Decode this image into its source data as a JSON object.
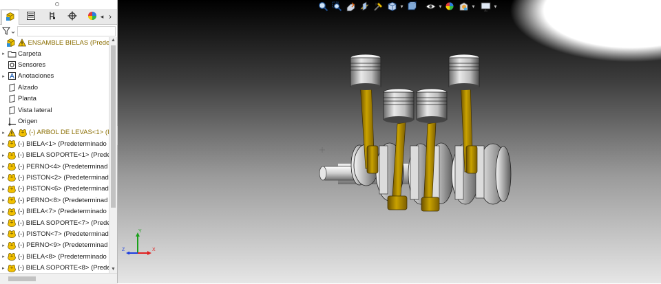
{
  "colors": {
    "assembly_yellow": "#e4b400",
    "warning_yellow": "#f2c200",
    "feature_blue": "#1e5fb4",
    "axis_x": "#e02020",
    "axis_y": "#1aa01a",
    "axis_z": "#1a3ce0"
  },
  "panel": {
    "tabs": [
      {
        "name": "featuremanager-tab",
        "icon": "assembly-tree-icon",
        "active": true
      },
      {
        "name": "propertymanager-tab",
        "icon": "property-list-icon",
        "active": false
      },
      {
        "name": "configurationmanager-tab",
        "icon": "configuration-icon",
        "active": false
      },
      {
        "name": "dimxpert-tab",
        "icon": "crosshair-icon",
        "active": false
      },
      {
        "name": "display-manager-tab",
        "icon": "appearance-icon",
        "active": false
      }
    ],
    "tab_arrows": {
      "left": "◂",
      "right": "›"
    },
    "filter_icon": "filter-icon",
    "tree": {
      "root": {
        "label": "ENSAMBLE BIELAS (Predeterm",
        "warning": true
      },
      "items": [
        {
          "label": "Carpeta",
          "icon": "folder-icon",
          "expandable": true
        },
        {
          "label": "Sensores",
          "icon": "sensor-icon",
          "expandable": false
        },
        {
          "label": "Anotaciones",
          "icon": "annotation-icon",
          "expandable": true
        },
        {
          "label": "Alzado",
          "icon": "plane-icon",
          "expandable": false
        },
        {
          "label": "Planta",
          "icon": "plane-icon",
          "expandable": false
        },
        {
          "label": "Vista lateral",
          "icon": "plane-icon",
          "expandable": false
        },
        {
          "label": "Origen",
          "icon": "origin-icon",
          "expandable": false
        },
        {
          "label": "(-) ARBOL DE LEVAS<1> (I",
          "icon": "part-icon",
          "expandable": true,
          "warning": true
        },
        {
          "label": "(-) BIELA<1> (Predeterminado",
          "icon": "part-icon",
          "expandable": true
        },
        {
          "label": "(-) BIELA SOPORTE<1> (Predet",
          "icon": "part-icon",
          "expandable": true
        },
        {
          "label": "(-) PERNO<4> (Predeterminad",
          "icon": "part-icon",
          "expandable": true
        },
        {
          "label": "(-) PISTON<2> (Predeterminad",
          "icon": "part-icon",
          "expandable": true
        },
        {
          "label": "(-) PISTON<6> (Predeterminad",
          "icon": "part-icon",
          "expandable": true
        },
        {
          "label": "(-) PERNO<8> (Predeterminad",
          "icon": "part-icon",
          "expandable": true
        },
        {
          "label": "(-) BIELA<7> (Predeterminado",
          "icon": "part-icon",
          "expandable": true
        },
        {
          "label": "(-) BIELA SOPORTE<7> (Predet",
          "icon": "part-icon",
          "expandable": true
        },
        {
          "label": "(-) PISTON<7> (Predeterminad",
          "icon": "part-icon",
          "expandable": true
        },
        {
          "label": "(-) PERNO<9> (Predeterminad",
          "icon": "part-icon",
          "expandable": true
        },
        {
          "label": "(-) BIELA<8> (Predeterminado",
          "icon": "part-icon",
          "expandable": true
        },
        {
          "label": "(-) BIELA SOPORTE<8> (Predet",
          "icon": "part-icon",
          "expandable": true
        }
      ]
    }
  },
  "viewport": {
    "heads_up_toolbar": [
      "zoom-to-fit-icon",
      "zoom-to-area-icon",
      "previous-view-icon",
      "section-view-icon",
      "dynamic-annotation-icon",
      "view-orientation-icon",
      "display-style-icon",
      "hide-show-items-icon",
      "edit-appearance-icon",
      "apply-scene-icon",
      "view-settings-icon"
    ],
    "triad": {
      "x_label": "X",
      "y_label": "Y",
      "z_label": "Z"
    }
  }
}
